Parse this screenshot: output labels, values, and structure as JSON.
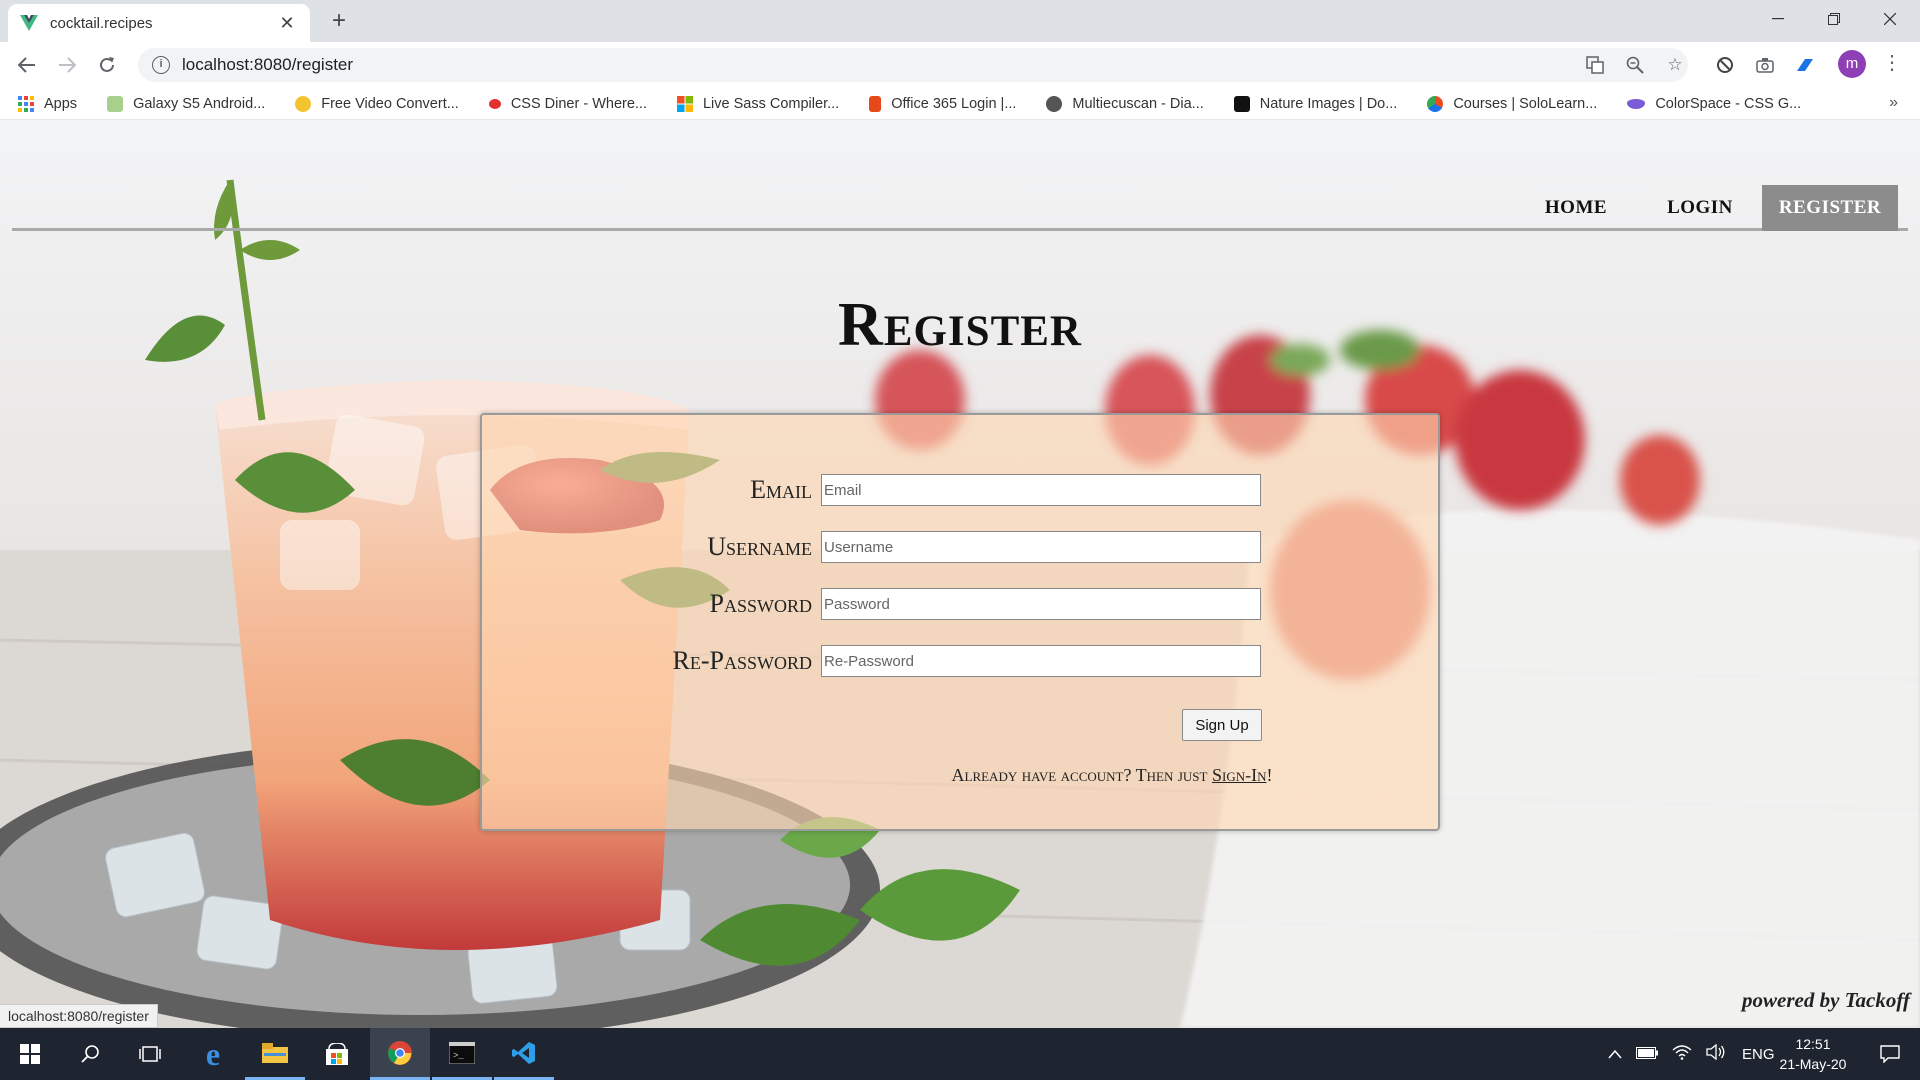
{
  "browser": {
    "tab_title": "cocktail.recipes",
    "tab_close": "✕",
    "new_tab": "+",
    "url": "localhost:8080/register",
    "bookmarks": [
      {
        "label": "Apps",
        "color": "#4285f4"
      },
      {
        "label": "Galaxy S5 Android...",
        "color": "#a8d08d"
      },
      {
        "label": "Free Video Convert...",
        "color": "#f4c430"
      },
      {
        "label": "CSS Diner - Where...",
        "color": "#e03030"
      },
      {
        "label": "Live Sass Compiler...",
        "color": "#f25022"
      },
      {
        "label": "Office 365 Login |...",
        "color": "#e64a19"
      },
      {
        "label": "Multiecuscan - Dia...",
        "color": "#555555"
      },
      {
        "label": "Nature Images | Do...",
        "color": "#111111"
      },
      {
        "label": "Courses | SoloLearn...",
        "color": "#e94e1b"
      },
      {
        "label": "ColorSpace - CSS G...",
        "color": "#7b5cd6"
      }
    ],
    "bookmarks_more": "»",
    "profile_initial": "m"
  },
  "nav": {
    "home": "HOME",
    "login": "LOGIN",
    "register": "REGISTER"
  },
  "page_title": "Register",
  "form": {
    "email_label": "Email",
    "email_placeholder": "Email",
    "username_label": "Username",
    "username_placeholder": "Username",
    "password_label": "Password",
    "password_placeholder": "Password",
    "repassword_label": "Re-Password",
    "repassword_placeholder": "Re-Password",
    "signup_label": "Sign Up",
    "already_text": "Already have account? Then just ",
    "signin_link": "Sign-In",
    "already_end": "!"
  },
  "footer": {
    "powered": "powered by Tackoff",
    "status_url": "localhost:8080/register"
  },
  "taskbar": {
    "language": "ENG",
    "time": "12:51",
    "date": "21-May-20"
  },
  "colors": {
    "active_nav": "#8c8c8c",
    "card": "#ffd6b2",
    "taskbar": "#1f2530",
    "accent": "#7ab4f5"
  }
}
